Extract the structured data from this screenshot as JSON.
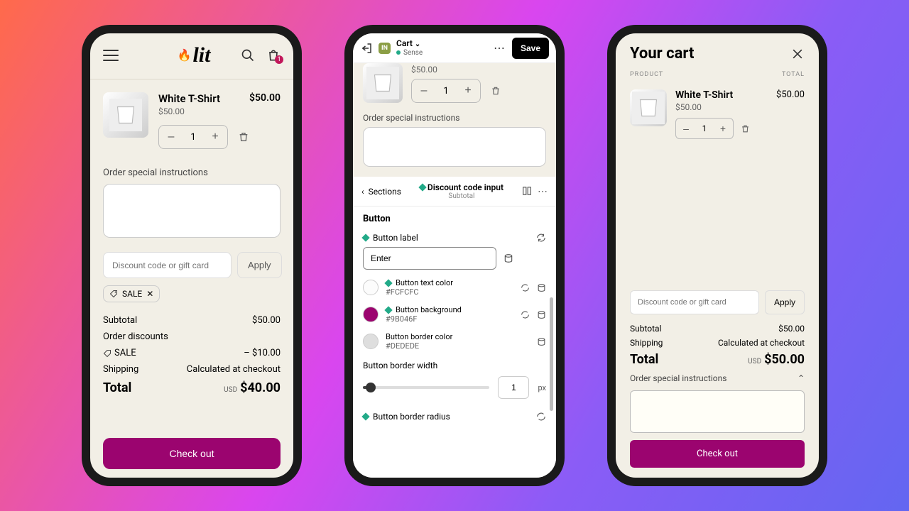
{
  "brand": {
    "name": "lit"
  },
  "phone1": {
    "cart_badge": "1",
    "item": {
      "title": "White T-Shirt",
      "price": "$50.00",
      "unit": "$50.00",
      "qty": "1"
    },
    "instructions_label": "Order special instructions",
    "discount_placeholder": "Discount code or gift card",
    "apply": "Apply",
    "chip": "SALE",
    "subtotal_label": "Subtotal",
    "subtotal": "$50.00",
    "discounts_label": "Order discounts",
    "sale_label": "SALE",
    "sale_amount": "– $10.00",
    "shipping_label": "Shipping",
    "shipping_value": "Calculated at checkout",
    "total_label": "Total",
    "currency": "USD",
    "total": "$40.00",
    "checkout": "Check out"
  },
  "phone2": {
    "topbar": {
      "badge": "IN",
      "title": "Cart",
      "status": "Sense",
      "save": "Save"
    },
    "preview": {
      "price": "$50.00",
      "qty": "1",
      "instructions_label": "Order special instructions"
    },
    "breadcrumb": {
      "back": "Sections",
      "title": "Discount code input",
      "subtitle": "Subtotal"
    },
    "section": "Button",
    "button_label_field": "Button label",
    "button_label_value": "Enter",
    "text_color": {
      "label": "Button text color",
      "hex": "#FCFCFC"
    },
    "bg_color": {
      "label": "Button background",
      "hex": "#9B046F"
    },
    "border_color": {
      "label": "Button border color",
      "hex": "#DEDEDE"
    },
    "border_width_label": "Button border width",
    "border_width_value": "1",
    "border_width_unit": "px",
    "border_radius_label": "Button border radius"
  },
  "phone3": {
    "title": "Your cart",
    "col_product": "PRODUCT",
    "col_total": "TOTAL",
    "item": {
      "title": "White T-Shirt",
      "price": "$50.00",
      "unit": "$50.00",
      "qty": "1"
    },
    "discount_placeholder": "Discount code or gift card",
    "apply": "Apply",
    "subtotal_label": "Subtotal",
    "subtotal": "$50.00",
    "shipping_label": "Shipping",
    "shipping_value": "Calculated at checkout",
    "total_label": "Total",
    "currency": "USD",
    "total": "$50.00",
    "instructions_label": "Order special instructions",
    "checkout": "Check out"
  }
}
